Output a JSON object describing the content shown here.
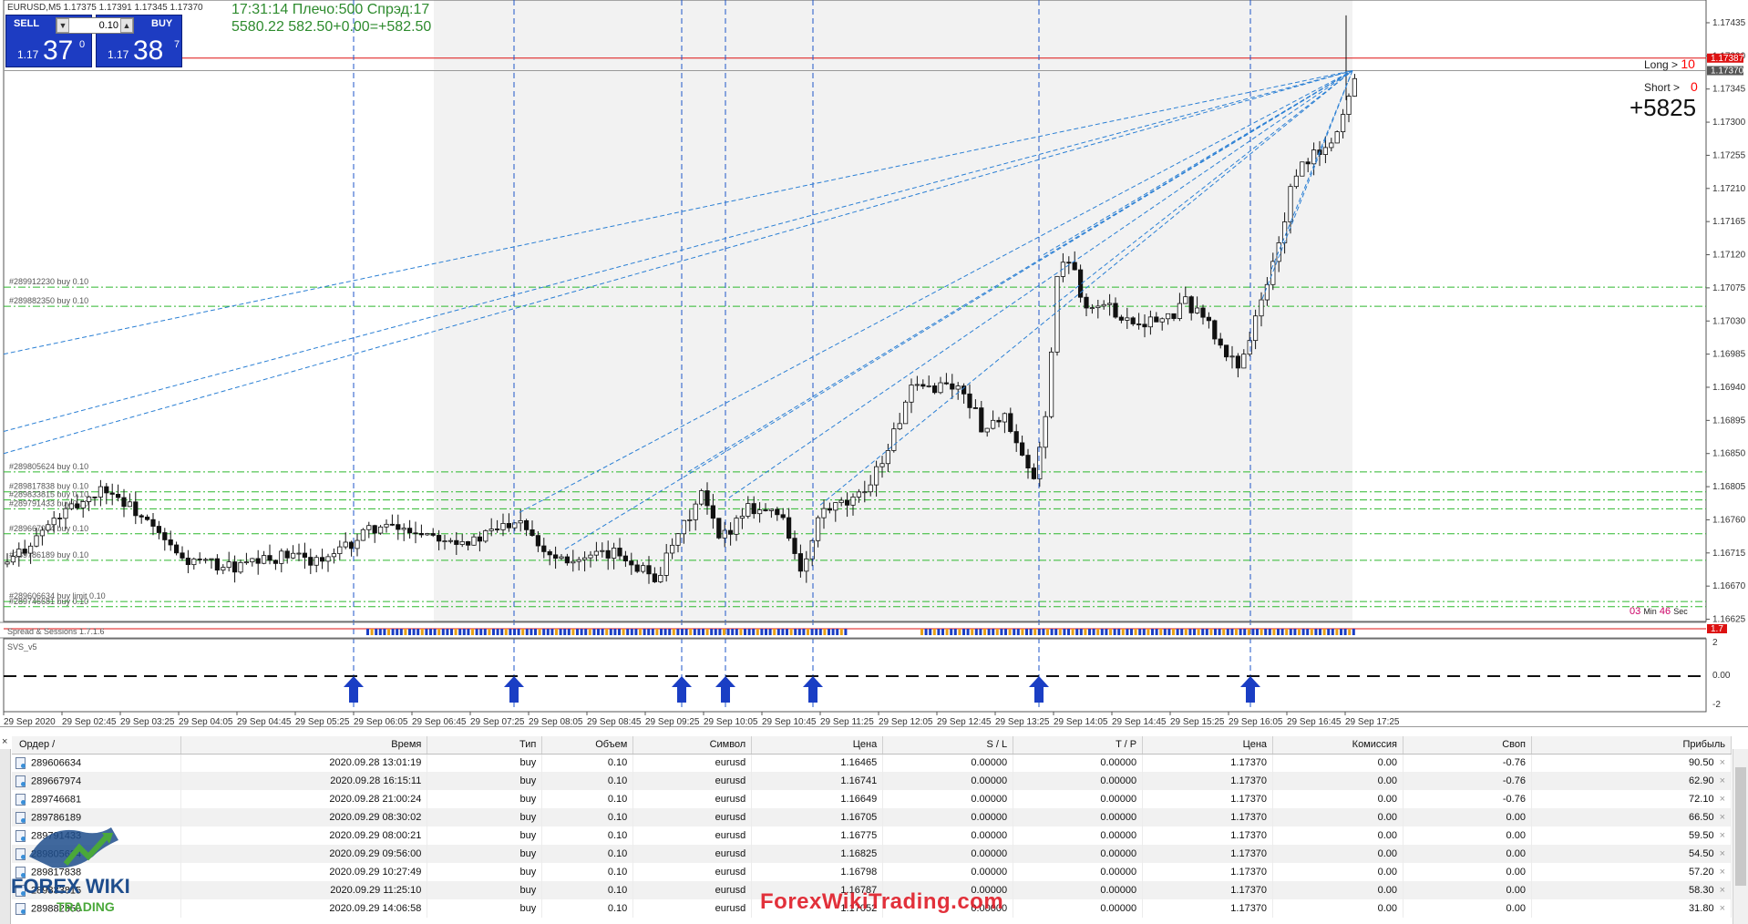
{
  "chart": {
    "symbol_line": "EURUSD,M5  1.17375 1.17391 1.17345 1.17370",
    "info_line": "17:31:14 Плечо:500 Спрэд:17",
    "balance_line": "5580.22   582.50+0.00=+582.50",
    "trade_panel": {
      "sell_label": "SELL",
      "buy_label": "BUY",
      "lot": "0.10",
      "lot_down": "▼",
      "lot_up": "▲",
      "sell_price_small": "1.17",
      "sell_price_big": "37",
      "sell_price_sup": "0",
      "buy_price_small": "1.17",
      "buy_price_big": "38",
      "buy_price_sup": "7"
    },
    "long_label": "Long >",
    "long_value": "10",
    "short_label": "Short >",
    "short_value": "0",
    "floating_profit": "+5825",
    "timer": {
      "min": "03",
      "min_unit": "Min",
      "sec": "46",
      "sec_unit": "Sec"
    },
    "price_scale": [
      "1.17435",
      "1.17390",
      "1.17345",
      "1.17300",
      "1.17255",
      "1.17210",
      "1.17165",
      "1.17120",
      "1.17075",
      "1.17030",
      "1.16985",
      "1.16940",
      "1.16895",
      "1.16850",
      "1.16805",
      "1.16760",
      "1.16715",
      "1.16670",
      "1.16625"
    ],
    "ask_tag": "1.17387",
    "bid_tag": "1.17370",
    "spread_tag": "1.7",
    "sub_scale": [
      "2",
      "0.00",
      "-2"
    ],
    "time_labels": [
      "29 Sep 2020",
      "29 Sep 02:45",
      "29 Sep 03:25",
      "29 Sep 04:05",
      "29 Sep 04:45",
      "29 Sep 05:25",
      "29 Sep 06:05",
      "29 Sep 06:45",
      "29 Sep 07:25",
      "29 Sep 08:05",
      "29 Sep 08:45",
      "29 Sep 09:25",
      "29 Sep 10:05",
      "29 Sep 10:45",
      "29 Sep 11:25",
      "29 Sep 12:05",
      "29 Sep 12:45",
      "29 Sep 13:25",
      "29 Sep 14:05",
      "29 Sep 14:45",
      "29 Sep 15:25",
      "29 Sep 16:05",
      "29 Sep 16:45",
      "29 Sep 17:25"
    ],
    "order_labels": [
      "#289912230 buy 0.10",
      "#289882350 buy 0.10",
      "#289805624 buy 0.10",
      "#289817838 buy 0.10",
      "#289833815 buy 0.10",
      "#289791433 buy 0.10",
      "#289667974 buy 0.10",
      "#289786189 buy 0.10",
      "#289606634 buy limit 0.10",
      "#289746681 buy 0.10"
    ],
    "indicator_spread": "Spread & Sessions 1.7.1.6",
    "indicator_svs": "SVS_v5",
    "colors": {
      "order_line": "#2db82d",
      "signal_line": "#1e55c8",
      "trend_line": "#2a7fd4",
      "ask_line": "#dd1111",
      "session_bar_a": "#1a3ec4",
      "session_bar_b": "#e8a013",
      "arrow": "#1a3ec4"
    }
  },
  "terminal": {
    "columns": [
      "Ордер",
      "Время",
      "Тип",
      "Объем",
      "Символ",
      "Цена",
      "S / L",
      "T / P",
      "Цена",
      "Комиссия",
      "Своп",
      "Прибыль"
    ],
    "sort_marker": "/",
    "rows": [
      [
        "289606634",
        "2020.09.28 13:01:19",
        "buy",
        "0.10",
        "eurusd",
        "1.16465",
        "0.00000",
        "0.00000",
        "1.17370",
        "0.00",
        "-0.76",
        "90.50"
      ],
      [
        "289667974",
        "2020.09.28 16:15:11",
        "buy",
        "0.10",
        "eurusd",
        "1.16741",
        "0.00000",
        "0.00000",
        "1.17370",
        "0.00",
        "-0.76",
        "62.90"
      ],
      [
        "289746681",
        "2020.09.28 21:00:24",
        "buy",
        "0.10",
        "eurusd",
        "1.16649",
        "0.00000",
        "0.00000",
        "1.17370",
        "0.00",
        "-0.76",
        "72.10"
      ],
      [
        "289786189",
        "2020.09.29 08:30:02",
        "buy",
        "0.10",
        "eurusd",
        "1.16705",
        "0.00000",
        "0.00000",
        "1.17370",
        "0.00",
        "0.00",
        "66.50"
      ],
      [
        "289791433",
        "2020.09.29 08:00:21",
        "buy",
        "0.10",
        "eurusd",
        "1.16775",
        "0.00000",
        "0.00000",
        "1.17370",
        "0.00",
        "0.00",
        "59.50"
      ],
      [
        "289805624",
        "2020.09.29 09:56:00",
        "buy",
        "0.10",
        "eurusd",
        "1.16825",
        "0.00000",
        "0.00000",
        "1.17370",
        "0.00",
        "0.00",
        "54.50"
      ],
      [
        "289817838",
        "2020.09.29 10:27:49",
        "buy",
        "0.10",
        "eurusd",
        "1.16798",
        "0.00000",
        "0.00000",
        "1.17370",
        "0.00",
        "0.00",
        "57.20"
      ],
      [
        "289833815",
        "2020.09.29 11:25:10",
        "buy",
        "0.10",
        "eurusd",
        "1.16787",
        "0.00000",
        "0.00000",
        "1.17370",
        "0.00",
        "0.00",
        "58.30"
      ],
      [
        "289882350",
        "2020.09.29 14:06:58",
        "buy",
        "0.10",
        "eurusd",
        "1.17052",
        "0.00000",
        "0.00000",
        "1.17370",
        "0.00",
        "0.00",
        "31.80"
      ]
    ]
  },
  "watermark": {
    "logo_top": "FOREX WIKI",
    "logo_bottom": "TRADING",
    "site": "ForexWikiTrading.com"
  }
}
